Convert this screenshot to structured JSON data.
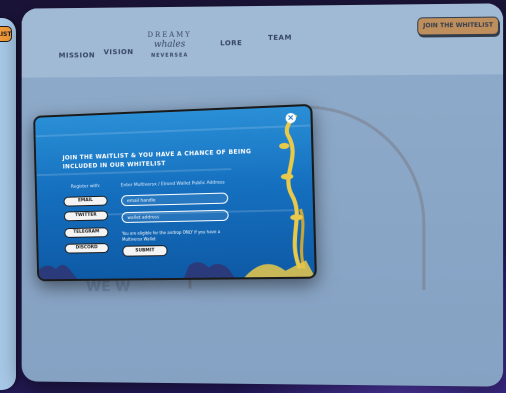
{
  "side_panel": {
    "badge_fragment": "LIST"
  },
  "nav": {
    "links": [
      "MISSION",
      "VISION",
      "LORE",
      "TEAM"
    ],
    "logo": {
      "line1": "DREAMY",
      "line2": "whales",
      "line3": "NEVERSEA"
    },
    "whitelist_button": "JOIN THE WHITELIST"
  },
  "background_text": {
    "fragment": "WE W"
  },
  "modal": {
    "title": "JOIN THE WAITLIST & YOU HAVE A CHANCE OF BEING INCLUDED IN OUR WHITELIST",
    "register_label": "Register with:",
    "address_label": "Enter Multiversx / Elrond Wallet Public Address",
    "options": [
      "EMAIL",
      "TWITTER",
      "TELEGRAM",
      "DISCORD"
    ],
    "email_placeholder": "email handle",
    "wallet_placeholder": "wallet address",
    "note": "You are eligible for the airdrop ONLY if you have a Multiversx Wallet",
    "submit_label": "SUBMIT",
    "close_label": "×"
  },
  "colors": {
    "accent_orange": "#f39a3a",
    "modal_blue": "#1570bf",
    "nav_bg": "#c3dcf1",
    "seaweed_yellow": "#e9c94a"
  }
}
